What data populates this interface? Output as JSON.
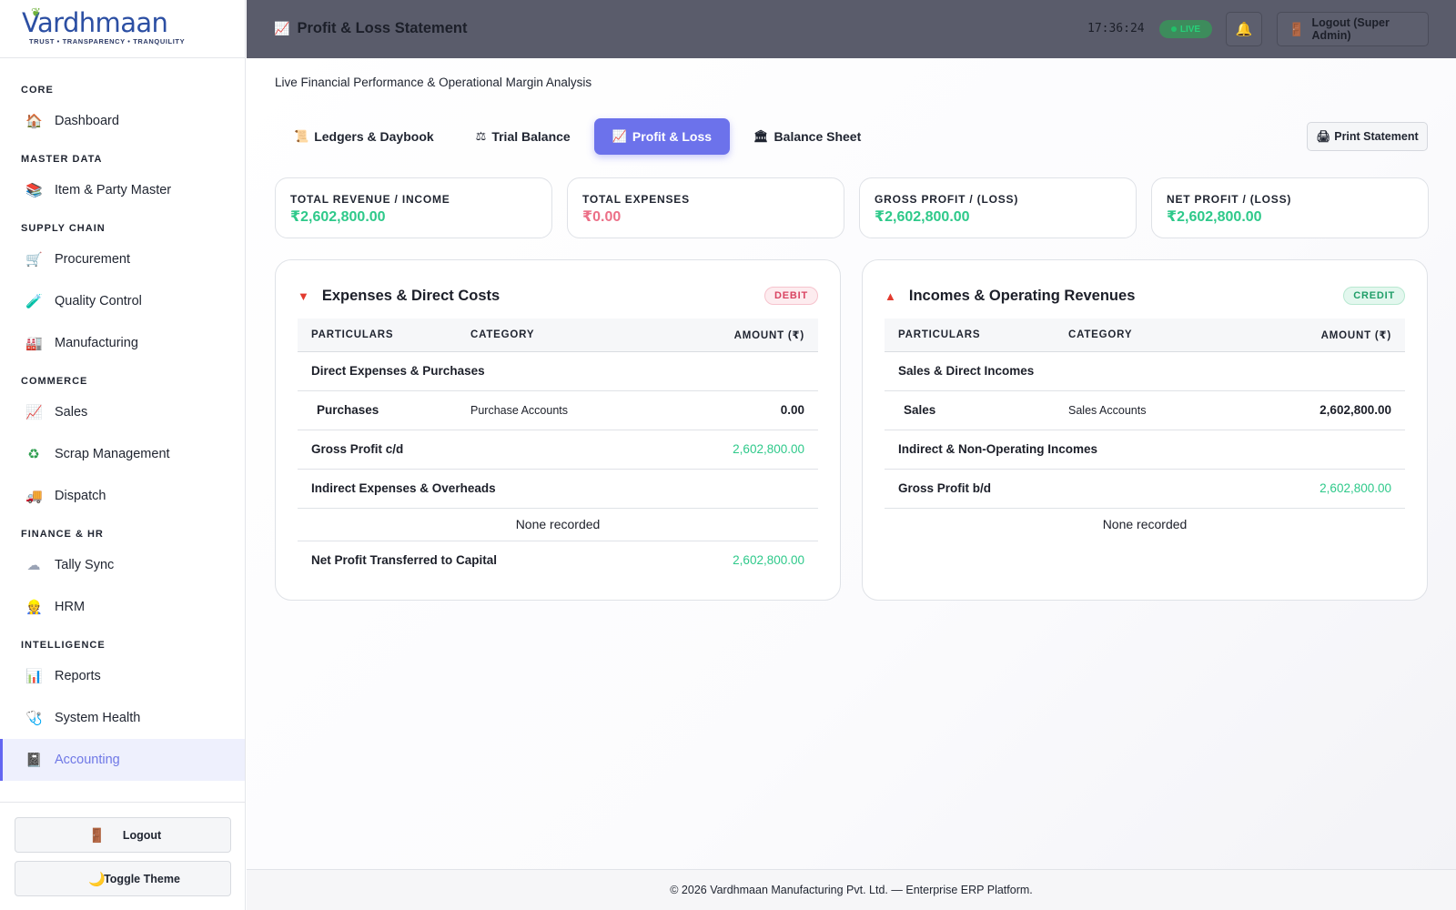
{
  "brand": {
    "name": "Vardhmaan",
    "tagline": "TRUST • TRANSPARENCY • TRANQUILITY"
  },
  "sidebar": {
    "sections": [
      {
        "title": "CORE",
        "items": [
          {
            "label": "Dashboard",
            "icon": "home-icon"
          }
        ]
      },
      {
        "title": "MASTER DATA",
        "items": [
          {
            "label": "Item & Party Master",
            "icon": "books-icon"
          }
        ]
      },
      {
        "title": "SUPPLY CHAIN",
        "items": [
          {
            "label": "Procurement",
            "icon": "cart-icon"
          },
          {
            "label": "Quality Control",
            "icon": "test-tube-icon"
          },
          {
            "label": "Manufacturing",
            "icon": "factory-icon"
          }
        ]
      },
      {
        "title": "COMMERCE",
        "items": [
          {
            "label": "Sales",
            "icon": "chart-up-icon"
          },
          {
            "label": "Scrap Management",
            "icon": "recycle-icon"
          },
          {
            "label": "Dispatch",
            "icon": "truck-icon"
          }
        ]
      },
      {
        "title": "FINANCE & HR",
        "items": [
          {
            "label": "Tally Sync",
            "icon": "cloud-icon"
          },
          {
            "label": "HRM",
            "icon": "worker-icon"
          }
        ]
      },
      {
        "title": "INTELLIGENCE",
        "items": [
          {
            "label": "Reports",
            "icon": "bar-chart-icon"
          },
          {
            "label": "System Health",
            "icon": "stethoscope-icon"
          },
          {
            "label": "Accounting",
            "icon": "ledger-icon",
            "active": true
          }
        ]
      }
    ],
    "footer": {
      "logout_label": "Logout",
      "theme_label": "Toggle Theme"
    }
  },
  "header": {
    "title": "Profit & Loss Statement",
    "clock": "17:36:24",
    "live_label": "LIVE",
    "logout_label": "Logout (Super Admin)"
  },
  "main": {
    "subtitle": "Live Financial Performance & Operational Margin Analysis",
    "tabs": [
      {
        "label": "Ledgers & Daybook",
        "icon": "scroll-icon"
      },
      {
        "label": "Trial Balance",
        "icon": "scales-icon"
      },
      {
        "label": "Profit & Loss",
        "icon": "chart-up-icon",
        "active": true
      },
      {
        "label": "Balance Sheet",
        "icon": "bank-icon"
      }
    ],
    "print_label": "Print Statement",
    "cards": [
      {
        "label": "TOTAL REVENUE / INCOME",
        "value": "₹2,602,800.00",
        "tone": "green"
      },
      {
        "label": "TOTAL EXPENSES",
        "value": "₹0.00",
        "tone": "red"
      },
      {
        "label": "GROSS PROFIT / (LOSS)",
        "value": "₹2,602,800.00",
        "tone": "green"
      },
      {
        "label": "NET PROFIT / (LOSS)",
        "value": "₹2,602,800.00",
        "tone": "green"
      }
    ],
    "expenses": {
      "title": "Expenses & Direct Costs",
      "badge": "DEBIT",
      "columns": [
        "PARTICULARS",
        "CATEGORY",
        "AMOUNT (₹)"
      ],
      "group_direct": "Direct Expenses & Purchases",
      "item_name": "Purchases",
      "item_category": "Purchase Accounts",
      "item_amount": "0.00",
      "gross_label": "Gross Profit c/d",
      "gross_amount": "2,602,800.00",
      "group_indirect": "Indirect Expenses & Overheads",
      "empty_text": "None recorded",
      "net_label": "Net Profit Transferred to Capital",
      "net_amount": "2,602,800.00"
    },
    "incomes": {
      "title": "Incomes & Operating Revenues",
      "badge": "CREDIT",
      "columns": [
        "PARTICULARS",
        "CATEGORY",
        "AMOUNT (₹)"
      ],
      "group_direct": "Sales & Direct Incomes",
      "item_name": "Sales",
      "item_category": "Sales Accounts",
      "item_amount": "2,602,800.00",
      "group_indirect": "Indirect & Non-Operating Incomes",
      "gross_label": "Gross Profit b/d",
      "gross_amount": "2,602,800.00",
      "empty_text": "None recorded"
    }
  },
  "footer": {
    "text": "© 2026 Vardhmaan Manufacturing Pvt. Ltd. — Enterprise ERP Platform."
  },
  "colors": {
    "accent": "#6366f1",
    "positive": "#2ec98a",
    "negative": "#ec6f87",
    "topbar": "#5a5c6b"
  }
}
